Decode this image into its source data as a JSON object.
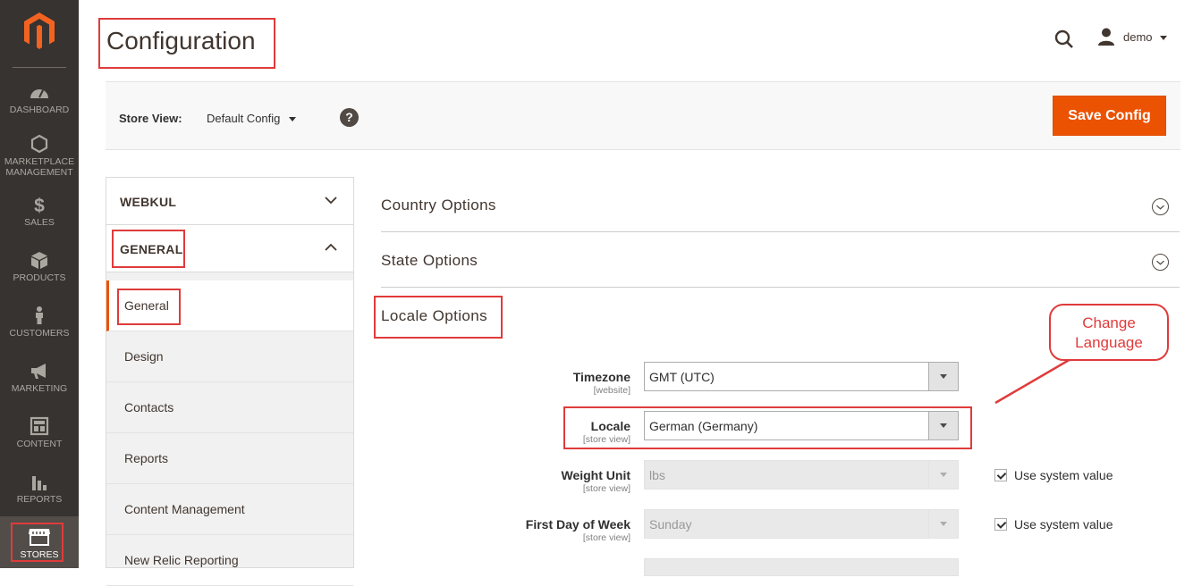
{
  "nav": [
    {
      "label": "DASHBOARD",
      "icon": "dashboard-icon"
    },
    {
      "label": "MARKETPLACE MANAGEMENT",
      "icon": "hexagon-icon"
    },
    {
      "label": "SALES",
      "icon": "dollar-icon"
    },
    {
      "label": "PRODUCTS",
      "icon": "cube-icon"
    },
    {
      "label": "CUSTOMERS",
      "icon": "person-icon"
    },
    {
      "label": "MARKETING",
      "icon": "megaphone-icon"
    },
    {
      "label": "CONTENT",
      "icon": "layout-icon"
    },
    {
      "label": "REPORTS",
      "icon": "bar-chart-icon"
    },
    {
      "label": "STORES",
      "icon": "storefront-icon"
    }
  ],
  "header": {
    "title": "Configuration",
    "user": "demo"
  },
  "store_bar": {
    "label": "Store View:",
    "value": "Default Config",
    "help": "?",
    "save": "Save Config"
  },
  "tabs": {
    "groups": [
      "WEBKUL",
      "GENERAL"
    ],
    "items": [
      "General",
      "Design",
      "Contacts",
      "Reports",
      "Content Management",
      "New Relic Reporting"
    ]
  },
  "sections": {
    "country": "Country Options",
    "state": "State Options",
    "locale": "Locale Options"
  },
  "fields": [
    {
      "label": "Timezone",
      "scope": "[website]",
      "value": "GMT (UTC)"
    },
    {
      "label": "Locale",
      "scope": "[store view]",
      "value": "German (Germany)"
    },
    {
      "label": "Weight Unit",
      "scope": "[store view]",
      "value": "lbs",
      "system": "Use system value"
    },
    {
      "label": "First Day of Week",
      "scope": "[store view]",
      "value": "Sunday",
      "system": "Use system value"
    }
  ],
  "callout": {
    "line1": "Change",
    "line2": "Language"
  },
  "colors": {
    "sidebar": "#373330",
    "accent": "#eb5202",
    "annotation": "#e03b3b"
  }
}
